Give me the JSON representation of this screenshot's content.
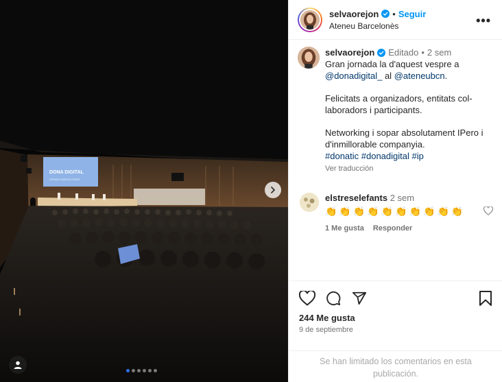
{
  "photo": {
    "screen_title": "DONA DIGITAL",
    "screen_subtitle": "ATENEU BARCELONÈS",
    "carousel": {
      "count": 6,
      "active_index": 0
    }
  },
  "header": {
    "username": "selvaorejon",
    "separator": "•",
    "follow_label": "Seguir",
    "location": "Ateneu Barcelonès",
    "more_label": "•••"
  },
  "caption": {
    "username": "selvaorejon",
    "edited": "Editado",
    "separator": "•",
    "time": "2 sem",
    "line1": "Gran jornada la d'aquest vespre a",
    "mention1": "@donadigital_",
    "al": "al",
    "mention2": "@ateneubcn",
    "period": ".",
    "para2": "Felicitats a organizadors, entitats col-laboradors i participants.",
    "para3": "Networking i sopar absolutament IPero i d'inmillorable companyia.",
    "hashtags": "#donatic #donadigital #ip",
    "translate": "Ver traducción"
  },
  "comment": {
    "username": "elstreselefants",
    "time": "2 sem",
    "emojis": "👏👏👏👏👏👏👏👏👏👏",
    "likes": "1 Me gusta",
    "reply": "Responder"
  },
  "actions": {
    "likes": "244 Me gusta",
    "date": "9 de septiembre"
  },
  "limited_comments": "Se han limitado los comentarios en esta publicación.",
  "colors": {
    "accent": "#0095f6",
    "link": "#00376b",
    "muted": "#737373"
  }
}
